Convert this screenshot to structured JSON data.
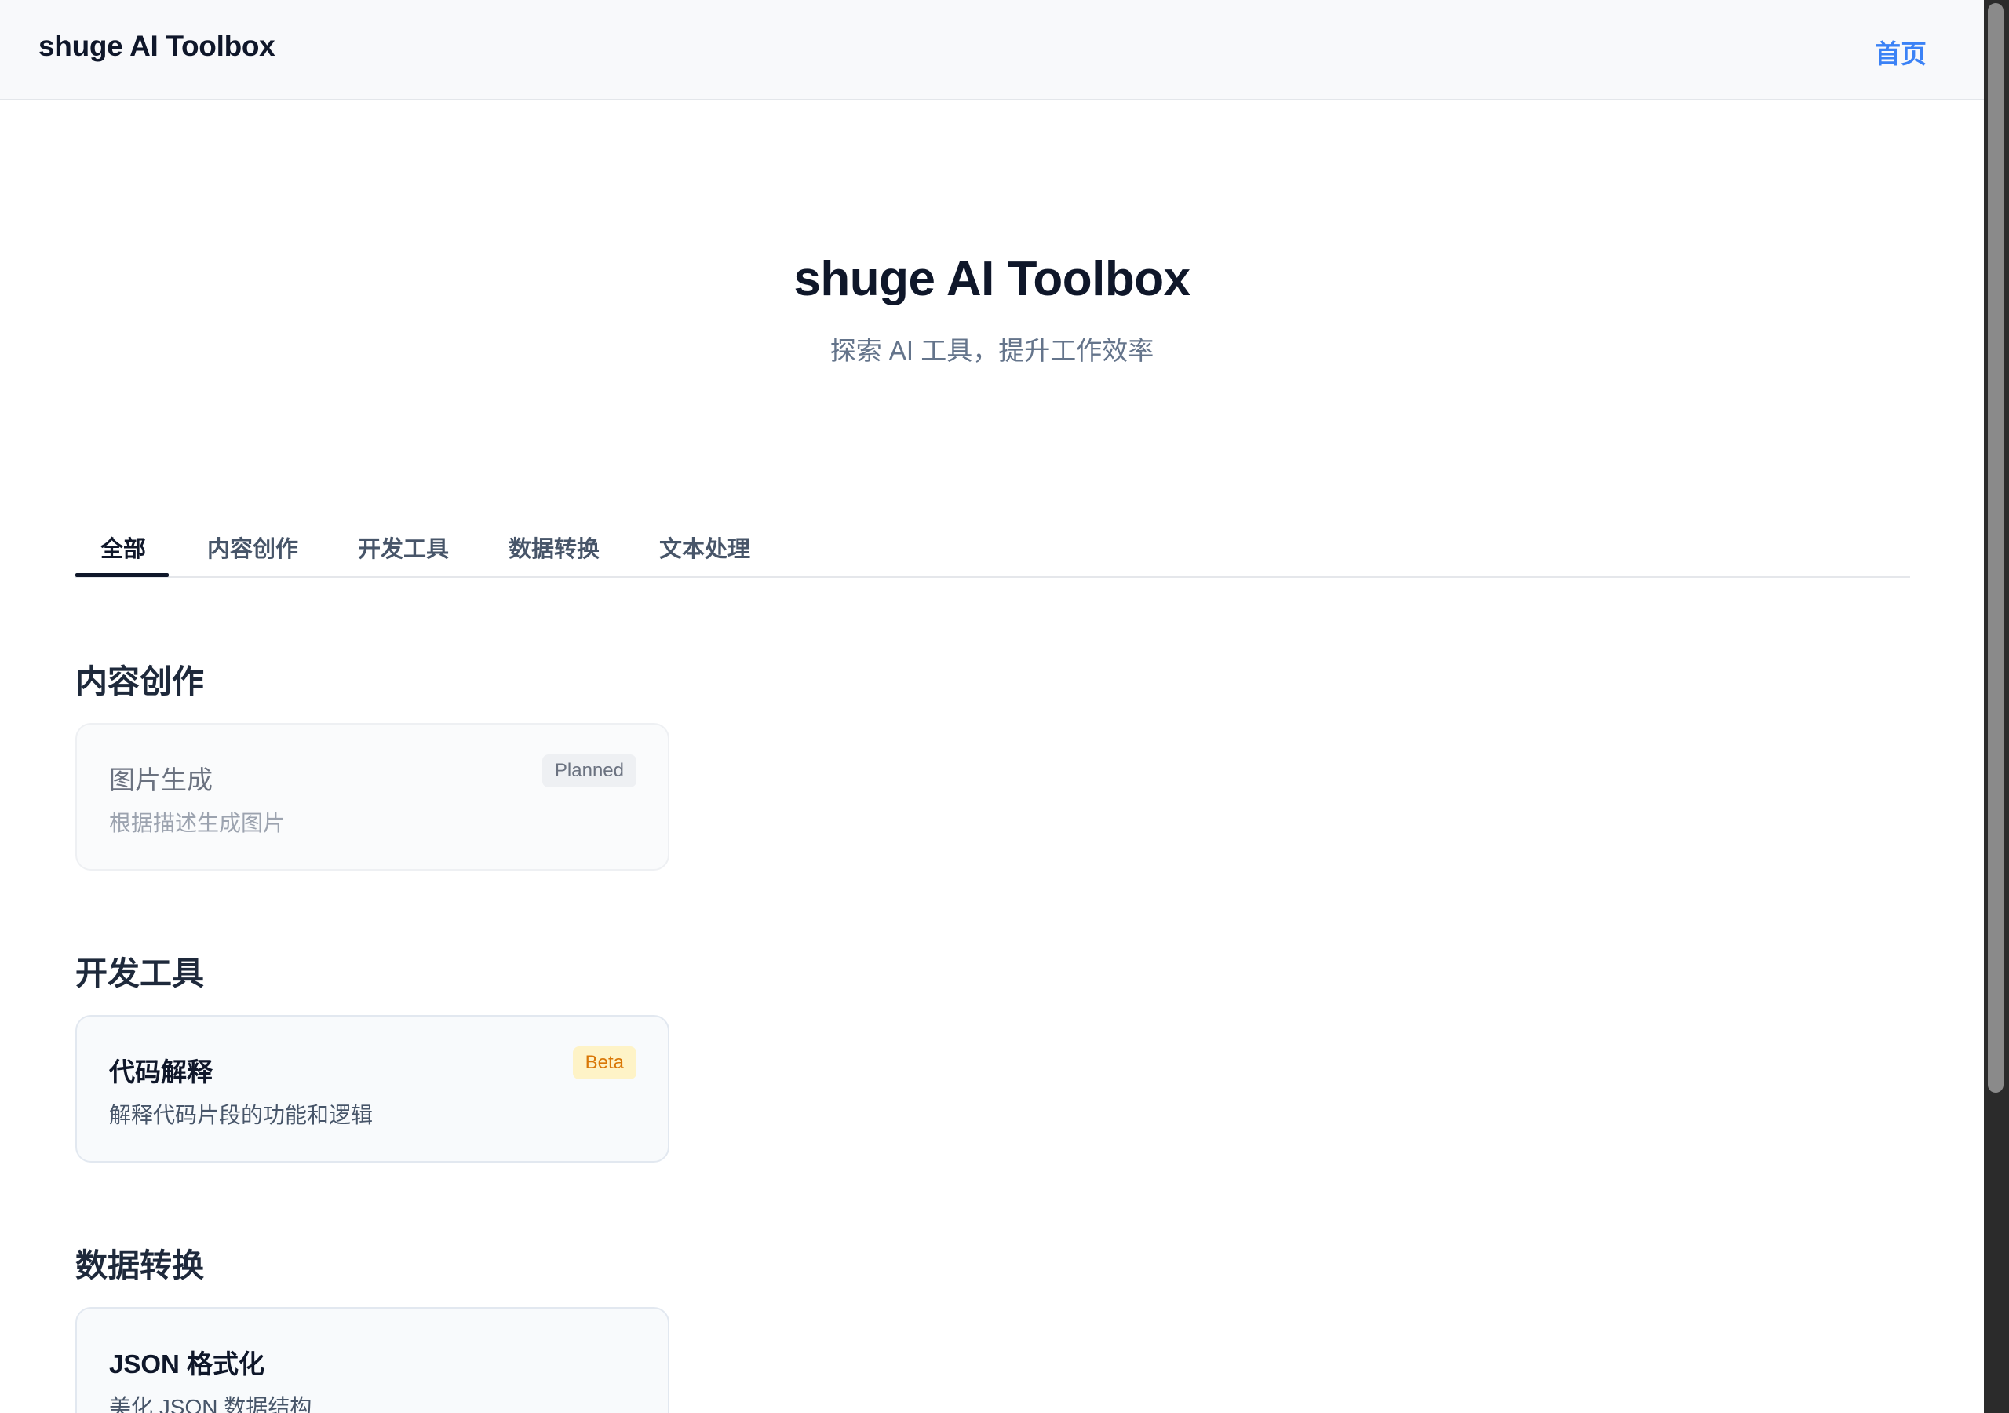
{
  "header": {
    "brand": "shuge AI Toolbox",
    "nav_home": "首页"
  },
  "hero": {
    "title": "shuge AI Toolbox",
    "subtitle": "探索 AI 工具，提升工作效率"
  },
  "tabs": [
    {
      "label": "全部",
      "active": true
    },
    {
      "label": "内容创作",
      "active": false
    },
    {
      "label": "开发工具",
      "active": false
    },
    {
      "label": "数据转换",
      "active": false
    },
    {
      "label": "文本处理",
      "active": false
    }
  ],
  "sections": [
    {
      "title": "内容创作",
      "cards": [
        {
          "title": "图片生成",
          "description": "根据描述生成图片",
          "badge": "Planned"
        }
      ]
    },
    {
      "title": "开发工具",
      "cards": [
        {
          "title": "代码解释",
          "description": "解释代码片段的功能和逻辑",
          "badge": "Beta"
        }
      ]
    },
    {
      "title": "数据转换",
      "cards": [
        {
          "title": "JSON 格式化",
          "description": "美化 JSON 数据结构",
          "badge": ""
        }
      ]
    }
  ],
  "colors": {
    "accent": "#3b82f6",
    "beta_badge_bg": "#fef3c7",
    "beta_badge_text": "#d97706",
    "planned_badge_bg": "#eef0f3"
  }
}
